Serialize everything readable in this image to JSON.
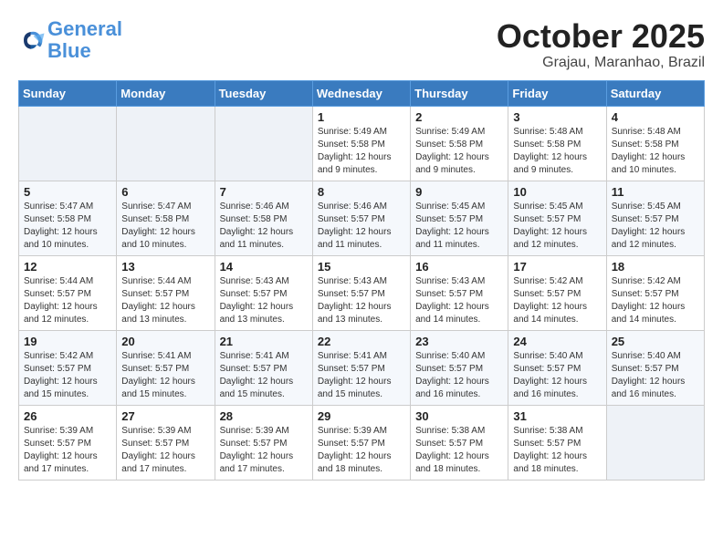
{
  "logo": {
    "line1": "General",
    "line2": "Blue"
  },
  "title": "October 2025",
  "location": "Grajau, Maranhao, Brazil",
  "weekdays": [
    "Sunday",
    "Monday",
    "Tuesday",
    "Wednesday",
    "Thursday",
    "Friday",
    "Saturday"
  ],
  "weeks": [
    [
      {
        "day": "",
        "sunrise": "",
        "sunset": "",
        "daylight": ""
      },
      {
        "day": "",
        "sunrise": "",
        "sunset": "",
        "daylight": ""
      },
      {
        "day": "",
        "sunrise": "",
        "sunset": "",
        "daylight": ""
      },
      {
        "day": "1",
        "sunrise": "Sunrise: 5:49 AM",
        "sunset": "Sunset: 5:58 PM",
        "daylight": "Daylight: 12 hours and 9 minutes."
      },
      {
        "day": "2",
        "sunrise": "Sunrise: 5:49 AM",
        "sunset": "Sunset: 5:58 PM",
        "daylight": "Daylight: 12 hours and 9 minutes."
      },
      {
        "day": "3",
        "sunrise": "Sunrise: 5:48 AM",
        "sunset": "Sunset: 5:58 PM",
        "daylight": "Daylight: 12 hours and 9 minutes."
      },
      {
        "day": "4",
        "sunrise": "Sunrise: 5:48 AM",
        "sunset": "Sunset: 5:58 PM",
        "daylight": "Daylight: 12 hours and 10 minutes."
      }
    ],
    [
      {
        "day": "5",
        "sunrise": "Sunrise: 5:47 AM",
        "sunset": "Sunset: 5:58 PM",
        "daylight": "Daylight: 12 hours and 10 minutes."
      },
      {
        "day": "6",
        "sunrise": "Sunrise: 5:47 AM",
        "sunset": "Sunset: 5:58 PM",
        "daylight": "Daylight: 12 hours and 10 minutes."
      },
      {
        "day": "7",
        "sunrise": "Sunrise: 5:46 AM",
        "sunset": "Sunset: 5:58 PM",
        "daylight": "Daylight: 12 hours and 11 minutes."
      },
      {
        "day": "8",
        "sunrise": "Sunrise: 5:46 AM",
        "sunset": "Sunset: 5:57 PM",
        "daylight": "Daylight: 12 hours and 11 minutes."
      },
      {
        "day": "9",
        "sunrise": "Sunrise: 5:45 AM",
        "sunset": "Sunset: 5:57 PM",
        "daylight": "Daylight: 12 hours and 11 minutes."
      },
      {
        "day": "10",
        "sunrise": "Sunrise: 5:45 AM",
        "sunset": "Sunset: 5:57 PM",
        "daylight": "Daylight: 12 hours and 12 minutes."
      },
      {
        "day": "11",
        "sunrise": "Sunrise: 5:45 AM",
        "sunset": "Sunset: 5:57 PM",
        "daylight": "Daylight: 12 hours and 12 minutes."
      }
    ],
    [
      {
        "day": "12",
        "sunrise": "Sunrise: 5:44 AM",
        "sunset": "Sunset: 5:57 PM",
        "daylight": "Daylight: 12 hours and 12 minutes."
      },
      {
        "day": "13",
        "sunrise": "Sunrise: 5:44 AM",
        "sunset": "Sunset: 5:57 PM",
        "daylight": "Daylight: 12 hours and 13 minutes."
      },
      {
        "day": "14",
        "sunrise": "Sunrise: 5:43 AM",
        "sunset": "Sunset: 5:57 PM",
        "daylight": "Daylight: 12 hours and 13 minutes."
      },
      {
        "day": "15",
        "sunrise": "Sunrise: 5:43 AM",
        "sunset": "Sunset: 5:57 PM",
        "daylight": "Daylight: 12 hours and 13 minutes."
      },
      {
        "day": "16",
        "sunrise": "Sunrise: 5:43 AM",
        "sunset": "Sunset: 5:57 PM",
        "daylight": "Daylight: 12 hours and 14 minutes."
      },
      {
        "day": "17",
        "sunrise": "Sunrise: 5:42 AM",
        "sunset": "Sunset: 5:57 PM",
        "daylight": "Daylight: 12 hours and 14 minutes."
      },
      {
        "day": "18",
        "sunrise": "Sunrise: 5:42 AM",
        "sunset": "Sunset: 5:57 PM",
        "daylight": "Daylight: 12 hours and 14 minutes."
      }
    ],
    [
      {
        "day": "19",
        "sunrise": "Sunrise: 5:42 AM",
        "sunset": "Sunset: 5:57 PM",
        "daylight": "Daylight: 12 hours and 15 minutes."
      },
      {
        "day": "20",
        "sunrise": "Sunrise: 5:41 AM",
        "sunset": "Sunset: 5:57 PM",
        "daylight": "Daylight: 12 hours and 15 minutes."
      },
      {
        "day": "21",
        "sunrise": "Sunrise: 5:41 AM",
        "sunset": "Sunset: 5:57 PM",
        "daylight": "Daylight: 12 hours and 15 minutes."
      },
      {
        "day": "22",
        "sunrise": "Sunrise: 5:41 AM",
        "sunset": "Sunset: 5:57 PM",
        "daylight": "Daylight: 12 hours and 15 minutes."
      },
      {
        "day": "23",
        "sunrise": "Sunrise: 5:40 AM",
        "sunset": "Sunset: 5:57 PM",
        "daylight": "Daylight: 12 hours and 16 minutes."
      },
      {
        "day": "24",
        "sunrise": "Sunrise: 5:40 AM",
        "sunset": "Sunset: 5:57 PM",
        "daylight": "Daylight: 12 hours and 16 minutes."
      },
      {
        "day": "25",
        "sunrise": "Sunrise: 5:40 AM",
        "sunset": "Sunset: 5:57 PM",
        "daylight": "Daylight: 12 hours and 16 minutes."
      }
    ],
    [
      {
        "day": "26",
        "sunrise": "Sunrise: 5:39 AM",
        "sunset": "Sunset: 5:57 PM",
        "daylight": "Daylight: 12 hours and 17 minutes."
      },
      {
        "day": "27",
        "sunrise": "Sunrise: 5:39 AM",
        "sunset": "Sunset: 5:57 PM",
        "daylight": "Daylight: 12 hours and 17 minutes."
      },
      {
        "day": "28",
        "sunrise": "Sunrise: 5:39 AM",
        "sunset": "Sunset: 5:57 PM",
        "daylight": "Daylight: 12 hours and 17 minutes."
      },
      {
        "day": "29",
        "sunrise": "Sunrise: 5:39 AM",
        "sunset": "Sunset: 5:57 PM",
        "daylight": "Daylight: 12 hours and 18 minutes."
      },
      {
        "day": "30",
        "sunrise": "Sunrise: 5:38 AM",
        "sunset": "Sunset: 5:57 PM",
        "daylight": "Daylight: 12 hours and 18 minutes."
      },
      {
        "day": "31",
        "sunrise": "Sunrise: 5:38 AM",
        "sunset": "Sunset: 5:57 PM",
        "daylight": "Daylight: 12 hours and 18 minutes."
      },
      {
        "day": "",
        "sunrise": "",
        "sunset": "",
        "daylight": ""
      }
    ]
  ]
}
